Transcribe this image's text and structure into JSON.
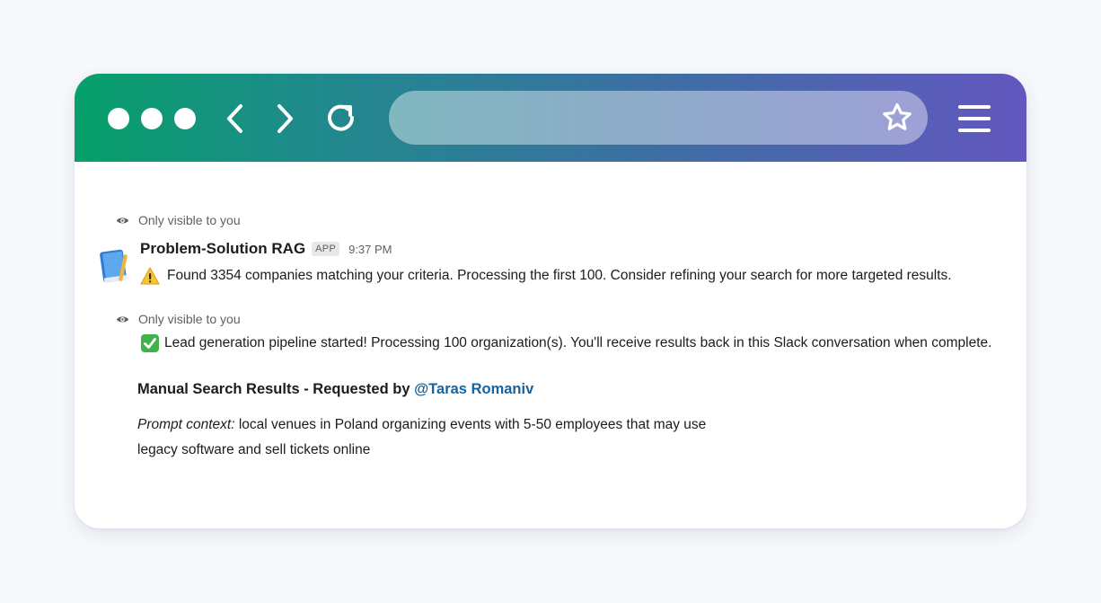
{
  "browser": {
    "toolbar": {
      "icons": [
        "traffic-dot",
        "traffic-dot",
        "traffic-dot",
        "back-arrow-icon",
        "forward-arrow-icon",
        "reload-icon",
        "star-icon",
        "hamburger-menu-icon"
      ],
      "address_value": "",
      "colors": {
        "gradient_start": "#06a06a",
        "gradient_end": "#6257bf"
      }
    }
  },
  "messages": {
    "visibility_note_1": "Only visible to you",
    "visibility_note_2": "Only visible to you",
    "sender": "Problem-Solution RAG",
    "app_badge": "APP",
    "timestamp": "9:37 PM",
    "warning_text": "Found 3354 companies matching your criteria. Processing the first 100. Consider refining your search for more targeted results.",
    "success_text": "Lead generation pipeline started! Processing 100 organization(s). You'll receive results back in this Slack conversation when complete.",
    "results_title": "Manual Search Results - Requested by ",
    "results_mention": "@Taras Romaniv",
    "prompt_label": "Prompt context:",
    "prompt_line_1": " local venues in Poland organizing events with 5-50 employees that may use",
    "prompt_line_2": "legacy software and sell tickets online",
    "colors": {
      "mention": "#1264a3",
      "text": "#1d1c1d",
      "muted": "#616061"
    }
  }
}
